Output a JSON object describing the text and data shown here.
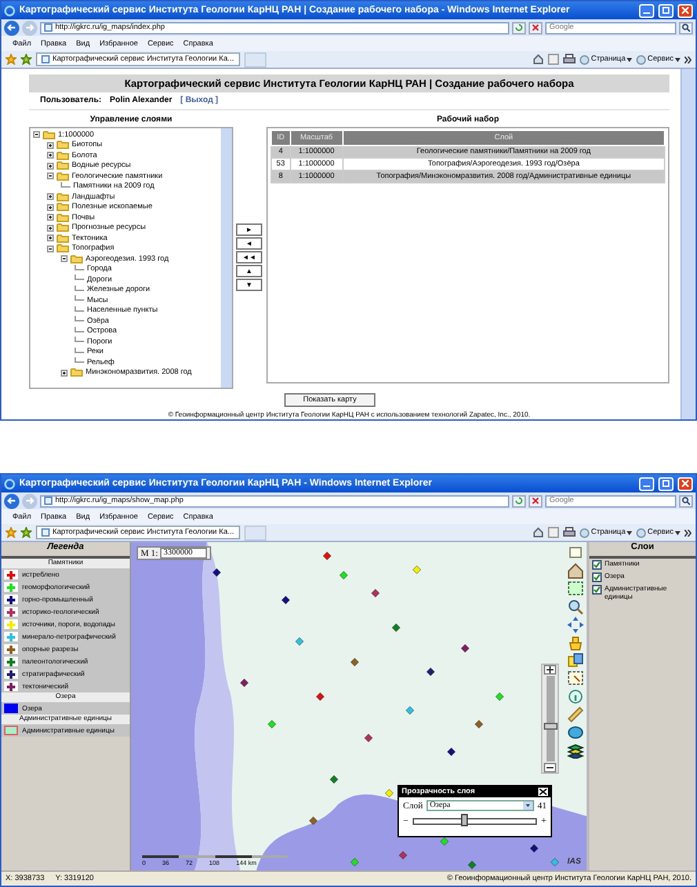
{
  "set_window": {
    "chrome": {
      "title": "Картографический сервис Института Геологии КарНЦ РАН | Создание рабочего набора - Windows Internet Explorer",
      "address": "http://igkrc.ru/ig_maps/index.php",
      "search_placeholder": "Google",
      "menu": [
        "Файл",
        "Правка",
        "Вид",
        "Избранное",
        "Сервис",
        "Справка"
      ],
      "tab": "Картографический сервис Института Геологии Ка...",
      "toolbar": [
        "Страница",
        "Сервис"
      ]
    },
    "header": "Картографический сервис Института Геологии КарНЦ РАН | Создание рабочего набора",
    "user_label": "Пользователь:",
    "user_name": "Polin Alexander",
    "logout": "[ Выход ]",
    "tree_title": "Управление слоями",
    "tree": [
      {
        "label": "1:1000000",
        "expanded": true,
        "children": [
          {
            "label": "Биотопы",
            "expanded": false
          },
          {
            "label": "Болота",
            "expanded": false
          },
          {
            "label": "Водные ресурсы",
            "expanded": false
          },
          {
            "label": "Геологические памятники",
            "expanded": true,
            "children": [
              {
                "label": "Памятники на 2009 год"
              }
            ]
          },
          {
            "label": "Ландшафты",
            "expanded": false
          },
          {
            "label": "Полезные ископаемые",
            "expanded": false
          },
          {
            "label": "Почвы",
            "expanded": false
          },
          {
            "label": "Прогнозные ресурсы",
            "expanded": false
          },
          {
            "label": "Тектоника",
            "expanded": false
          },
          {
            "label": "Топография",
            "expanded": true,
            "children": [
              {
                "label": "Аэрогеодезия. 1993 год",
                "expanded": true,
                "children": [
                  {
                    "label": "Города"
                  },
                  {
                    "label": "Дороги"
                  },
                  {
                    "label": "Железные дороги"
                  },
                  {
                    "label": "Мысы"
                  },
                  {
                    "label": "Населенные пункты"
                  },
                  {
                    "label": "Озёра"
                  },
                  {
                    "label": "Острова"
                  },
                  {
                    "label": "Пороги"
                  },
                  {
                    "label": "Реки"
                  },
                  {
                    "label": "Рельеф"
                  }
                ]
              },
              {
                "label": "Минэкономразвития. 2008 год",
                "expanded": false
              }
            ]
          }
        ]
      }
    ],
    "move_buttons": [
      "►",
      "◄",
      "◄◄",
      "▲",
      "▼"
    ],
    "set_title": "Рабочий набор",
    "table": {
      "columns": [
        "ID",
        "Масштаб",
        "Слой"
      ],
      "rows": [
        {
          "cells": [
            "4",
            "1:1000000",
            "Геологические памятники/Памятники на 2009 год"
          ]
        },
        {
          "cells": [
            "53",
            "1:1000000",
            "Топография/Аэрогеодезия. 1993 год/Озёра"
          ]
        },
        {
          "cells": [
            "8",
            "1:1000000",
            "Топография/Минэкономразвития. 2008 год/Административные единицы"
          ]
        }
      ]
    },
    "show_map_button": "Показать карту",
    "footer": "© Геоинформационный центр Института Геологии КарНЦ РАН с использованием технологий Zapatec, Inc., 2010."
  },
  "map_window": {
    "chrome": {
      "title": "Картографический сервис Института Геологии КарНЦ РАН - Windows Internet Explorer",
      "address": "http://igkrc.ru/ig_maps/show_map.php",
      "search_placeholder": "Google",
      "menu": [
        "Файл",
        "Правка",
        "Вид",
        "Избранное",
        "Сервис",
        "Справка"
      ],
      "tab": "Картографический сервис Института Геологии Ка...",
      "toolbar": [
        "Страница",
        "Сервис"
      ]
    },
    "legend_title": "Легенда",
    "legend": [
      {
        "kind": "section",
        "label": "Памятники"
      },
      {
        "kind": "point",
        "label": "истреблено",
        "color": "#e01010"
      },
      {
        "kind": "point",
        "label": "геоморфологический",
        "color": "#20e020"
      },
      {
        "kind": "point",
        "label": "горно-промышленный",
        "color": "#101080"
      },
      {
        "kind": "point",
        "label": "историко-геологический",
        "color": "#b03060"
      },
      {
        "kind": "point",
        "label": "источники, пороги, водопады",
        "color": "#f0f000"
      },
      {
        "kind": "point",
        "label": "минерало-петрографический",
        "color": "#30c0e0"
      },
      {
        "kind": "point",
        "label": "опорные разрезы",
        "color": "#906020"
      },
      {
        "kind": "point",
        "label": "палеонтологический",
        "color": "#108020"
      },
      {
        "kind": "point",
        "label": "стратиграфический",
        "color": "#202070"
      },
      {
        "kind": "point",
        "label": "тектонический",
        "color": "#802060"
      },
      {
        "kind": "section",
        "label": "Озера"
      },
      {
        "kind": "fill",
        "label": "Озера",
        "color": "#0000f0"
      },
      {
        "kind": "section",
        "label": "Административные единицы"
      },
      {
        "kind": "fill",
        "label": "Административные единицы",
        "color": "#a8f0c8"
      }
    ],
    "scale_label": "М 1:",
    "scale_value": "3300000",
    "scale_bar": [
      "0",
      "36",
      "72",
      "108",
      "144 km"
    ],
    "zoom_slider": {
      "level": 0.4
    },
    "logo": "IAS",
    "transparency": {
      "title": "Прозрачность слоя",
      "layer_label": "Слой",
      "layer_value": "Озера",
      "value": "41",
      "level": 0.41,
      "minus": "−",
      "plus": "+"
    },
    "layers_title": "Слои",
    "layers": [
      {
        "label": "Памятники",
        "checked": true
      },
      {
        "label": "Озера",
        "checked": true
      },
      {
        "label": "Административные единицы",
        "checked": true
      }
    ],
    "status": {
      "x": "X: 3938733",
      "y": "Y: 3319120",
      "copyright": "© Геоинформационный центр Института Геологии КарНЦ РАН, 2010."
    }
  }
}
